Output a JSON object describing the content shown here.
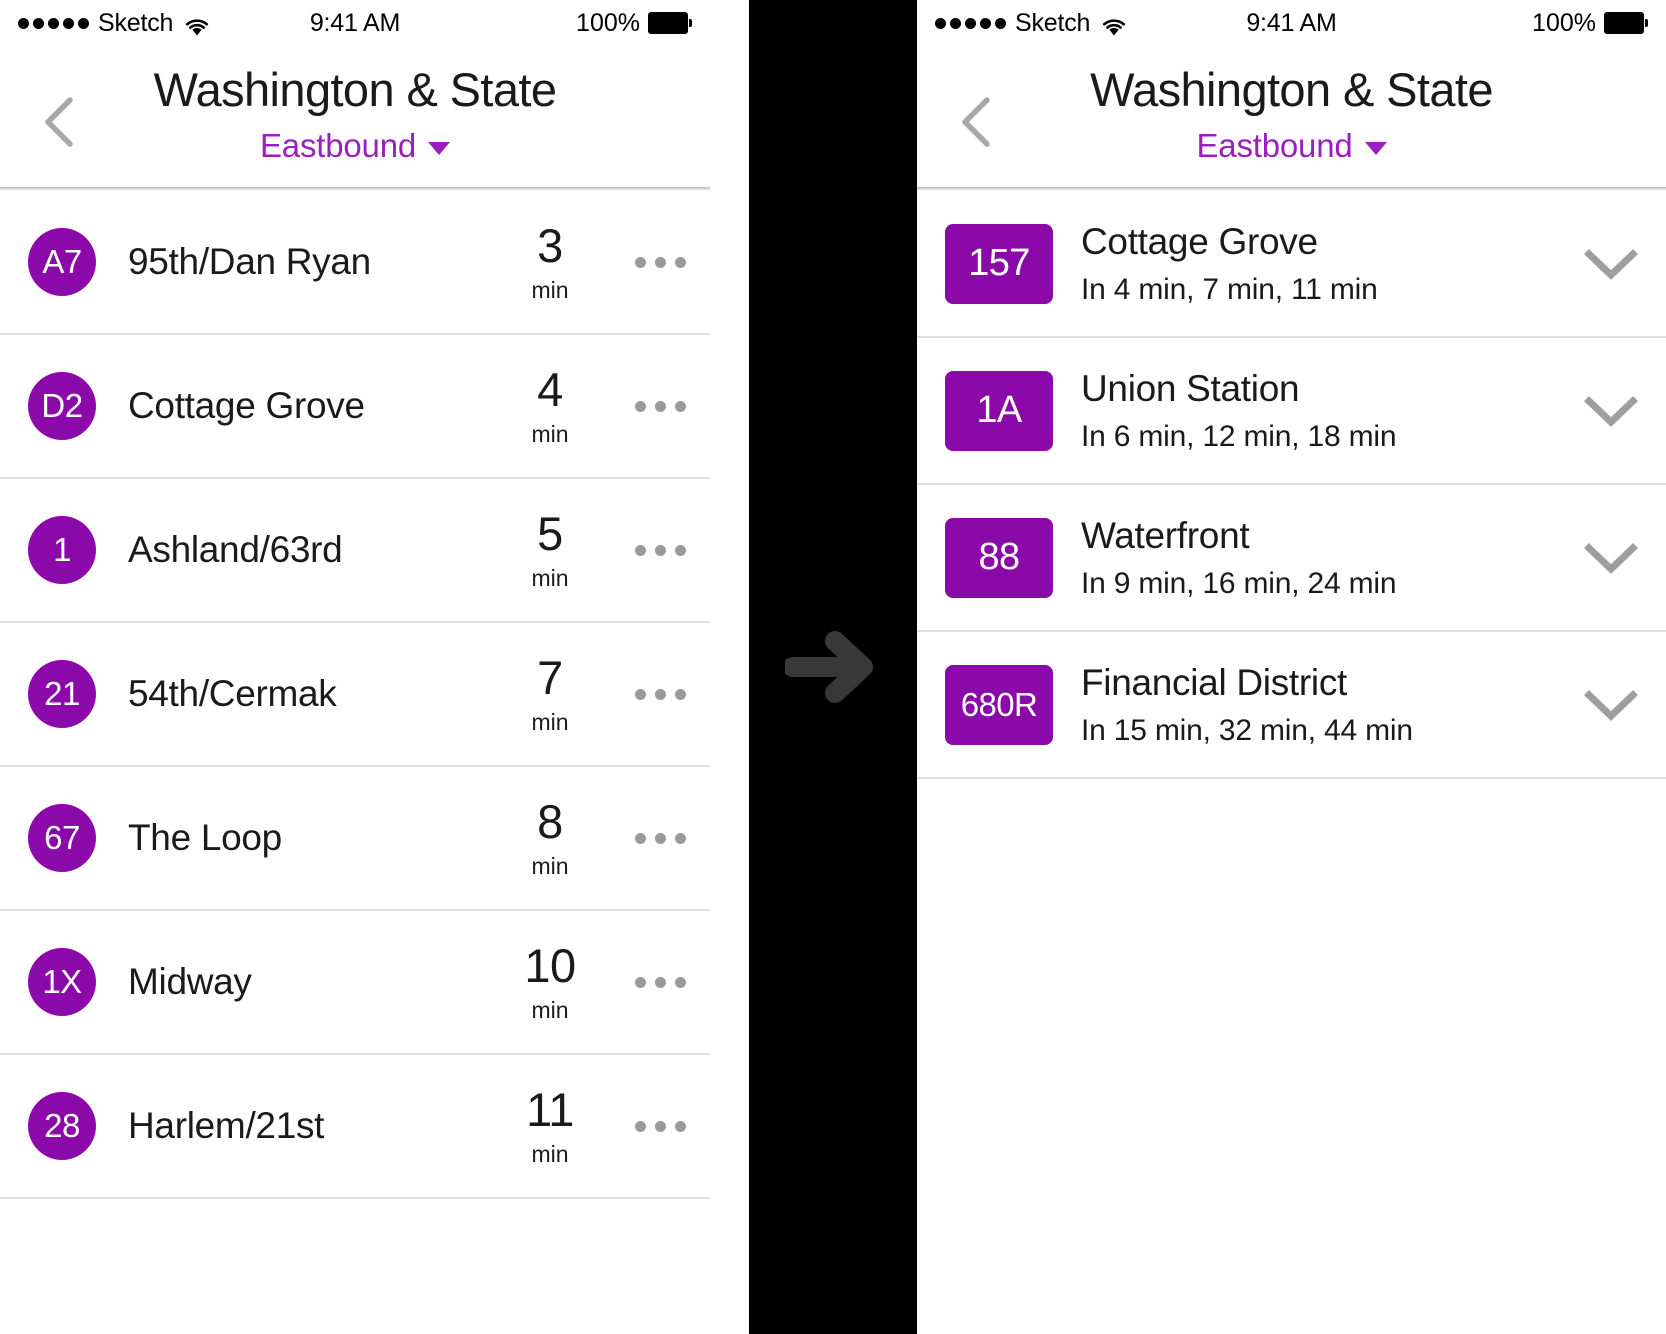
{
  "status_bar": {
    "carrier": "Sketch",
    "signal_dots": 5,
    "wifi_icon": "wifi-icon",
    "time": "9:41 AM",
    "battery_percent": "100%",
    "battery_icon": "battery-full-icon"
  },
  "nav": {
    "back_icon": "chevron-left-icon",
    "title": "Washington & State",
    "direction": "Eastbound",
    "direction_caret_icon": "caret-down-icon"
  },
  "divider": {
    "arrow_icon": "arrow-right-icon",
    "background": "#000000",
    "arrow_color": "#383838"
  },
  "theme": {
    "badge_purple": "#8A09A8",
    "accent_purple": "#9B1FBF",
    "separator": "#e0e0e0",
    "text_primary": "#1a1a1a",
    "dots_gray": "#9a9a9a",
    "chevron_gray": "#9e9e9e"
  },
  "left_screen": {
    "more_icon": "ellipsis-icon",
    "eta_unit": "min",
    "rows": [
      {
        "route": "A7",
        "destination": "95th/Dan Ryan",
        "eta": "3",
        "unit": "min"
      },
      {
        "route": "D2",
        "destination": "Cottage Grove",
        "eta": "4",
        "unit": "min"
      },
      {
        "route": "1",
        "destination": "Ashland/63rd",
        "eta": "5",
        "unit": "min"
      },
      {
        "route": "21",
        "destination": "54th/Cermak",
        "eta": "7",
        "unit": "min"
      },
      {
        "route": "67",
        "destination": "The Loop",
        "eta": "8",
        "unit": "min"
      },
      {
        "route": "1X",
        "destination": "Midway",
        "eta": "10",
        "unit": "min"
      },
      {
        "route": "28",
        "destination": "Harlem/21st",
        "eta": "11",
        "unit": "min"
      }
    ]
  },
  "right_screen": {
    "expand_icon": "chevron-down-icon",
    "rows": [
      {
        "route": "157",
        "destination": "Cottage Grove",
        "times": "In 4 min, 7 min, 11 min"
      },
      {
        "route": "1A",
        "destination": "Union Station",
        "times": "In 6 min, 12 min, 18 min"
      },
      {
        "route": "88",
        "destination": "Waterfront",
        "times": "In 9 min, 16 min, 24 min"
      },
      {
        "route": "680R",
        "destination": "Financial District",
        "times": "In 15 min, 32 min, 44 min"
      }
    ]
  }
}
